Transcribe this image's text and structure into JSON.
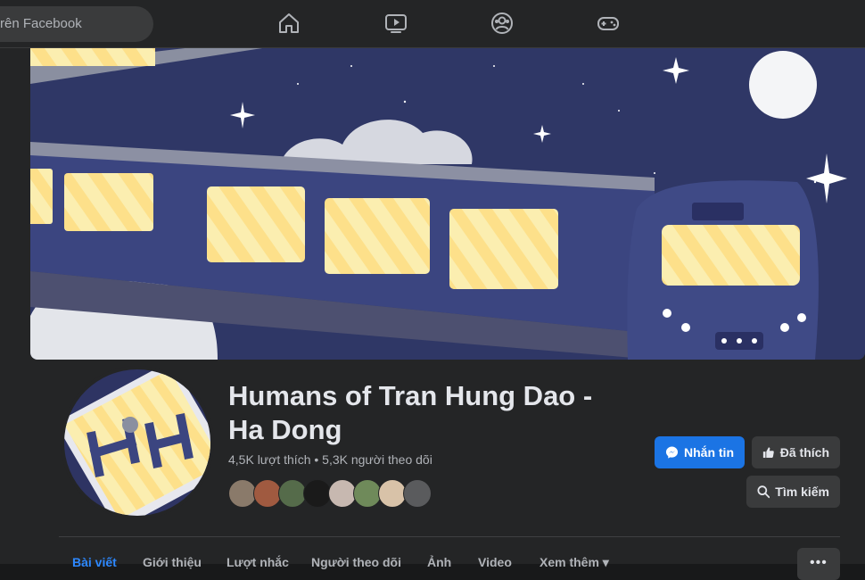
{
  "topbar": {
    "search_placeholder": "rên Facebook",
    "nav": [
      {
        "icon": "home-icon"
      },
      {
        "icon": "watch-icon"
      },
      {
        "icon": "groups-icon"
      },
      {
        "icon": "gaming-icon"
      }
    ]
  },
  "profile": {
    "title": "Humans of Tran Hung Dao - Ha Dong",
    "stats": "4,5K lượt thích • 5,3K người theo dõi"
  },
  "actions": {
    "message_label": "Nhắn tin",
    "liked_label": "Đã thích",
    "search_label": "Tìm kiếm"
  },
  "tabs": [
    {
      "label": "Bài viết",
      "active": true
    },
    {
      "label": "Giới thiệu"
    },
    {
      "label": "Lượt nhắc"
    },
    {
      "label": "Người theo dõi"
    },
    {
      "label": "Ảnh"
    },
    {
      "label": "Video"
    },
    {
      "label": "Xem thêm ▾"
    }
  ],
  "more_label": "•••",
  "colors": {
    "accent": "#1b74e4",
    "active_tab": "#2d88ff",
    "background": "#18191a",
    "surface": "#242526"
  }
}
